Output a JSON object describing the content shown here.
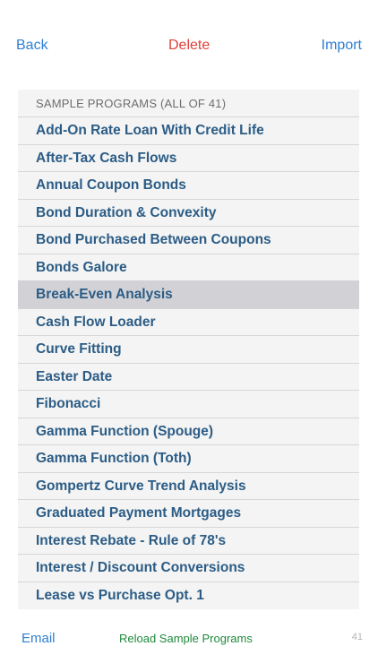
{
  "toolbar": {
    "back_label": "Back",
    "delete_label": "Delete",
    "import_label": "Import"
  },
  "list": {
    "header": "SAMPLE PROGRAMS (ALL OF 41)",
    "selected_index": 6,
    "items": [
      {
        "label": "Add-On Rate Loan With Credit Life"
      },
      {
        "label": "After-Tax Cash Flows"
      },
      {
        "label": "Annual Coupon Bonds"
      },
      {
        "label": "Bond Duration & Convexity"
      },
      {
        "label": "Bond Purchased Between Coupons"
      },
      {
        "label": "Bonds Galore"
      },
      {
        "label": "Break-Even Analysis"
      },
      {
        "label": "Cash Flow Loader"
      },
      {
        "label": "Curve Fitting"
      },
      {
        "label": "Easter Date"
      },
      {
        "label": "Fibonacci"
      },
      {
        "label": "Gamma Function (Spouge)"
      },
      {
        "label": "Gamma Function (Toth)"
      },
      {
        "label": "Gompertz Curve Trend Analysis"
      },
      {
        "label": "Graduated Payment Mortgages"
      },
      {
        "label": "Interest Rebate - Rule of 78's"
      },
      {
        "label": "Interest / Discount Conversions"
      },
      {
        "label": "Lease vs Purchase Opt. 1"
      }
    ]
  },
  "footer": {
    "email_label": "Email",
    "reload_label": "Reload Sample Programs",
    "count": "41"
  },
  "colors": {
    "link_blue": "#2f7fd3",
    "delete_red": "#e0413a",
    "item_text": "#2c5c86",
    "reload_green": "#1f8a3b",
    "selected_bg": "#d2d2d6",
    "panel_bg": "#f3f4f3"
  }
}
